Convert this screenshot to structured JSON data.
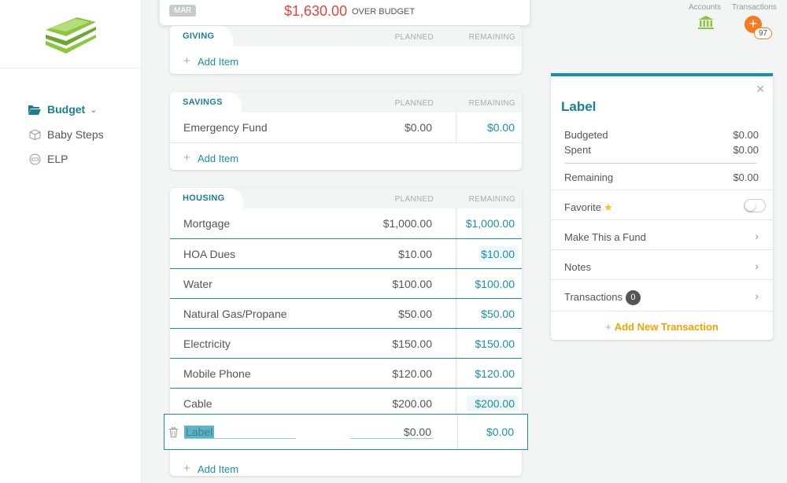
{
  "sidebar": {
    "items": [
      {
        "label": "Budget",
        "icon": "folder-open-icon",
        "active": true
      },
      {
        "label": "Baby Steps",
        "icon": "box-icon"
      },
      {
        "label": "ELP",
        "icon": "elp-icon"
      }
    ]
  },
  "banner": {
    "month": "MAR",
    "amount": "$1,630.00",
    "status": "OVER BUDGET"
  },
  "topbar": {
    "accounts_label": "Accounts",
    "transactions_label": "Transactions",
    "transactions_count": "97"
  },
  "columns": {
    "planned": "PLANNED",
    "remaining": "REMAINING"
  },
  "add_item_label": "Add Item",
  "groups": {
    "giving": {
      "title": "GIVING"
    },
    "savings": {
      "title": "SAVINGS",
      "items": [
        {
          "name": "Emergency Fund",
          "planned": "$0.00",
          "remaining": "$0.00"
        }
      ]
    },
    "housing": {
      "title": "HOUSING",
      "items": [
        {
          "name": "Mortgage",
          "planned": "$1,000.00",
          "remaining": "$1,000.00"
        },
        {
          "name": "HOA Dues",
          "planned": "$10.00",
          "remaining": "$10.00"
        },
        {
          "name": "Water",
          "planned": "$100.00",
          "remaining": "$100.00"
        },
        {
          "name": "Natural Gas/Propane",
          "planned": "$50.00",
          "remaining": "$50.00"
        },
        {
          "name": "Electricity",
          "planned": "$150.00",
          "remaining": "$150.00"
        },
        {
          "name": "Mobile Phone",
          "planned": "$120.00",
          "remaining": "$120.00"
        },
        {
          "name": "Cable",
          "planned": "$200.00",
          "remaining": "$200.00"
        }
      ],
      "editing": {
        "name": "Label",
        "planned": "$0.00",
        "remaining": "$0.00"
      }
    }
  },
  "panel": {
    "title": "Label",
    "budgeted_label": "Budgeted",
    "budgeted_value": "$0.00",
    "spent_label": "Spent",
    "spent_value": "$0.00",
    "remaining_label": "Remaining",
    "remaining_value": "$0.00",
    "favorite_label": "Favorite",
    "fund_label": "Make This a Fund",
    "notes_label": "Notes",
    "transactions_label": "Transactions",
    "transactions_count": "0",
    "add_transaction_label": "Add New Transaction"
  },
  "colors": {
    "teal": "#1a8fa8",
    "over_budget": "#e0463a",
    "orange": "#f47b20",
    "gold": "#f1a300"
  }
}
